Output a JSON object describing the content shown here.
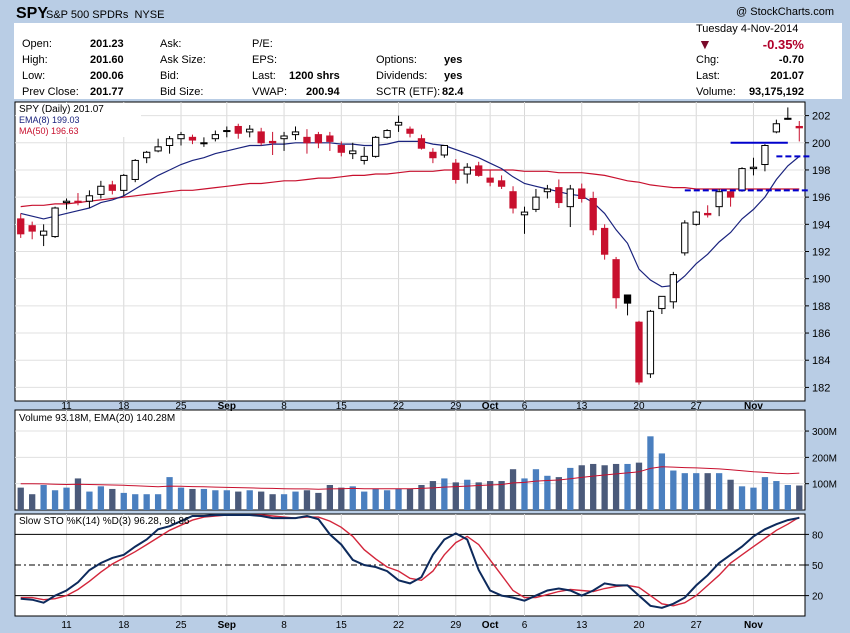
{
  "header": {
    "ticker": "SPY",
    "name": "S&P 500 SPDRs",
    "exchange": "NYSE",
    "copyright": "@ StockCharts.com",
    "date": "Tuesday  4-Nov-2014",
    "change_pct": "-0.35%",
    "fields": {
      "open_label": "Open:",
      "open": "201.23",
      "high_label": "High:",
      "high": "201.60",
      "low_label": "Low:",
      "low": "200.06",
      "prev_label": "Prev Close:",
      "prev": "201.77",
      "ask_label": "Ask:",
      "ask": "",
      "asksize_label": "Ask Size:",
      "asksize": "",
      "bid_label": "Bid:",
      "bid": "",
      "bidsize_label": "Bid Size:",
      "bidsize": "",
      "pe_label": "P/E:",
      "pe": "",
      "eps_label": "EPS:",
      "eps": "",
      "last_label": "Last:",
      "last": "1200 shrs",
      "vwap_label": "VWAP:",
      "vwap": "200.94",
      "options_label": "Options:",
      "options": "yes",
      "dividends_label": "Dividends:",
      "dividends": "yes",
      "sctr_label": "SCTR (ETF):",
      "sctr": "82.4",
      "chg_label": "Chg:",
      "chg": "-0.70",
      "last2_label": "Last:",
      "last2": "201.07",
      "volume_label": "Volume:",
      "volume": "93,175,192"
    }
  },
  "colors": {
    "up": "#ffffff",
    "down": "#c8102e",
    "ema": "#1a237e",
    "ma": "#c8102e",
    "vol_up": "#4a7fbf",
    "vol_down": "#4b5a7a",
    "stoK": "#0d2a5c",
    "stoD": "#d3263b",
    "bg": "#b9cde5"
  },
  "chart_data": [
    {
      "type": "candlestick",
      "legend": [
        "SPY (Daily) 201.07",
        "EMA(8) 199.03",
        "MA(50) 196.63"
      ],
      "x_labels": [
        "11",
        "18",
        "25",
        "Sep",
        "8",
        "15",
        "22",
        "29",
        "Oct",
        "6",
        "13",
        "20",
        "27",
        "Nov"
      ],
      "ylim": [
        181,
        203
      ],
      "y_ticks": [
        182,
        184,
        186,
        188,
        190,
        192,
        194,
        196,
        198,
        200,
        202
      ],
      "candles": [
        [
          194.4,
          194.8,
          193.0,
          193.3
        ],
        [
          193.9,
          194.2,
          192.9,
          193.5
        ],
        [
          193.2,
          194.0,
          192.4,
          193.5
        ],
        [
          193.1,
          195.3,
          193.0,
          195.2
        ],
        [
          195.6,
          195.9,
          195.1,
          195.7
        ],
        [
          195.7,
          196.3,
          195.4,
          195.6
        ],
        [
          195.7,
          196.5,
          195.2,
          196.1
        ],
        [
          196.2,
          197.2,
          195.9,
          196.8
        ],
        [
          196.9,
          197.2,
          196.2,
          196.5
        ],
        [
          196.5,
          197.7,
          196.1,
          197.6
        ],
        [
          197.3,
          198.8,
          197.1,
          198.7
        ],
        [
          198.9,
          199.4,
          198.5,
          199.3
        ],
        [
          199.4,
          200.3,
          199.3,
          199.7
        ],
        [
          199.8,
          200.5,
          199.2,
          200.3
        ],
        [
          200.3,
          200.8,
          199.8,
          200.6
        ],
        [
          200.4,
          200.6,
          199.9,
          200.2
        ],
        [
          200.0,
          200.4,
          199.7,
          200.0
        ],
        [
          200.3,
          200.9,
          200.1,
          200.6
        ],
        [
          200.9,
          201.2,
          200.4,
          200.9
        ],
        [
          201.2,
          201.4,
          200.3,
          200.7
        ],
        [
          200.8,
          201.3,
          200.4,
          201.0
        ],
        [
          200.8,
          201.1,
          199.8,
          200.0
        ],
        [
          200.1,
          200.8,
          199.1,
          200.0
        ],
        [
          200.3,
          200.8,
          199.4,
          200.5
        ],
        [
          200.6,
          201.2,
          200.2,
          200.8
        ],
        [
          200.4,
          201.0,
          199.2,
          200.0
        ],
        [
          200.6,
          200.8,
          199.6,
          200.0
        ],
        [
          200.5,
          200.8,
          199.4,
          200.1
        ],
        [
          199.8,
          200.1,
          199.0,
          199.3
        ],
        [
          199.2,
          200.0,
          198.8,
          199.4
        ],
        [
          198.7,
          199.7,
          198.4,
          199.0
        ],
        [
          199.0,
          200.5,
          198.9,
          200.4
        ],
        [
          200.4,
          201.0,
          200.3,
          200.9
        ],
        [
          201.3,
          202.0,
          200.8,
          201.5
        ],
        [
          201.0,
          201.2,
          200.4,
          200.7
        ],
        [
          200.3,
          200.6,
          199.5,
          199.6
        ],
        [
          199.3,
          199.6,
          198.5,
          198.9
        ],
        [
          199.1,
          199.8,
          198.9,
          199.8
        ],
        [
          198.5,
          198.8,
          197.0,
          197.3
        ],
        [
          197.7,
          198.5,
          197.0,
          198.2
        ],
        [
          198.3,
          198.6,
          197.5,
          197.6
        ],
        [
          197.4,
          198.0,
          196.8,
          197.1
        ],
        [
          197.2,
          197.6,
          196.6,
          196.8
        ],
        [
          196.4,
          196.8,
          194.8,
          195.2
        ],
        [
          194.7,
          195.3,
          193.3,
          194.9
        ],
        [
          195.1,
          196.6,
          194.9,
          196.0
        ],
        [
          196.4,
          196.9,
          195.9,
          196.6
        ],
        [
          196.7,
          197.3,
          195.2,
          195.6
        ],
        [
          195.3,
          196.9,
          193.8,
          196.6
        ],
        [
          196.6,
          197.0,
          195.6,
          195.9
        ],
        [
          195.9,
          196.4,
          193.2,
          193.6
        ],
        [
          193.7,
          194.0,
          191.4,
          191.8
        ],
        [
          191.4,
          191.6,
          187.8,
          188.6
        ],
        [
          188.2,
          188.7,
          187.3,
          188.8
        ],
        [
          186.8,
          186.9,
          182.2,
          182.4
        ],
        [
          183.0,
          187.7,
          182.7,
          187.6
        ],
        [
          187.8,
          188.7,
          187.4,
          188.7
        ],
        [
          188.3,
          190.5,
          187.8,
          190.3
        ],
        [
          191.9,
          194.3,
          191.7,
          194.1
        ],
        [
          194.0,
          195.0,
          193.9,
          194.9
        ],
        [
          194.8,
          195.4,
          194.5,
          194.7
        ],
        [
          195.3,
          196.6,
          194.6,
          196.4
        ],
        [
          196.4,
          196.5,
          195.3,
          196.0
        ],
        [
          196.5,
          198.2,
          196.4,
          198.1
        ],
        [
          198.1,
          198.9,
          197.6,
          198.2
        ],
        [
          198.4,
          199.9,
          197.9,
          199.8
        ],
        [
          200.8,
          201.7,
          200.7,
          201.4
        ],
        [
          201.8,
          202.6,
          201.7,
          201.8
        ],
        [
          201.2,
          201.6,
          200.1,
          201.1
        ]
      ],
      "ema8": [
        194.8,
        194.6,
        194.4,
        194.6,
        194.8,
        195.0,
        195.2,
        195.6,
        195.8,
        196.1,
        196.6,
        197.1,
        197.6,
        198.0,
        198.4,
        198.7,
        198.9,
        199.2,
        199.4,
        199.6,
        199.8,
        199.8,
        199.9,
        199.9,
        200.0,
        200.0,
        200.0,
        200.0,
        199.9,
        199.9,
        199.8,
        199.8,
        199.9,
        200.1,
        200.1,
        200.1,
        199.9,
        199.8,
        199.5,
        199.2,
        198.9,
        198.5,
        198.1,
        197.5,
        197.0,
        196.8,
        196.6,
        196.4,
        196.2,
        196.1,
        195.6,
        194.8,
        193.6,
        192.6,
        190.7,
        189.9,
        189.4,
        189.5,
        190.2,
        191.1,
        191.8,
        192.7,
        193.4,
        194.4,
        195.1,
        196.0,
        197.3,
        198.3,
        199.0
      ],
      "ma50": [
        195.3,
        195.4,
        195.4,
        195.5,
        195.5,
        195.6,
        195.7,
        195.8,
        195.9,
        196.0,
        196.1,
        196.2,
        196.3,
        196.4,
        196.5,
        196.5,
        196.6,
        196.7,
        196.8,
        196.9,
        197.0,
        197.0,
        197.1,
        197.2,
        197.2,
        197.3,
        197.4,
        197.4,
        197.5,
        197.6,
        197.6,
        197.7,
        197.7,
        197.8,
        197.9,
        197.9,
        197.9,
        198.0,
        198.0,
        198.0,
        198.0,
        198.0,
        198.0,
        198.0,
        197.9,
        197.9,
        197.9,
        197.8,
        197.8,
        197.8,
        197.7,
        197.6,
        197.4,
        197.2,
        197.1,
        196.9,
        196.8,
        196.7,
        196.7,
        196.6,
        196.6,
        196.6,
        196.6,
        196.6,
        196.6,
        196.6,
        196.6,
        196.6,
        196.6
      ],
      "annotations": [
        {
          "type": "hline",
          "y": 200.0,
          "from_index": 62,
          "to_index": 66,
          "style": "solid"
        },
        {
          "type": "hline",
          "y": 199.0,
          "from_index": 66,
          "to_index": 68,
          "style": "dashed"
        },
        {
          "type": "hline",
          "y": 196.5,
          "from_index": 58,
          "to_index": 68,
          "style": "dashed"
        }
      ]
    },
    {
      "type": "bar",
      "legend": "Volume 93.18M, EMA(20) 140.28M",
      "ylim": [
        0,
        380
      ],
      "y_ticks": [
        {
          "v": 100,
          "label": "100M"
        },
        {
          "v": 200,
          "label": "200M"
        },
        {
          "v": 300,
          "label": "300M"
        }
      ],
      "values": [
        85,
        60,
        95,
        75,
        85,
        120,
        70,
        90,
        80,
        65,
        60,
        60,
        60,
        125,
        85,
        80,
        80,
        75,
        75,
        70,
        75,
        70,
        60,
        60,
        70,
        75,
        65,
        95,
        85,
        90,
        70,
        80,
        75,
        80,
        80,
        95,
        110,
        120,
        105,
        115,
        105,
        110,
        110,
        155,
        120,
        155,
        130,
        125,
        160,
        170,
        175,
        170,
        175,
        175,
        180,
        280,
        215,
        150,
        140,
        140,
        140,
        140,
        115,
        90,
        85,
        125,
        110,
        95,
        93
      ],
      "ema20": [
        100,
        100,
        99,
        98,
        97,
        98,
        97,
        96,
        95,
        94,
        92,
        90,
        88,
        91,
        90,
        89,
        88,
        87,
        86,
        85,
        84,
        83,
        82,
        81,
        80,
        80,
        79,
        80,
        81,
        82,
        81,
        81,
        81,
        81,
        81,
        82,
        84,
        87,
        89,
        91,
        93,
        95,
        97,
        103,
        105,
        110,
        112,
        114,
        119,
        124,
        129,
        133,
        137,
        141,
        145,
        158,
        164,
        163,
        161,
        160,
        158,
        156,
        153,
        149,
        145,
        143,
        140,
        138,
        140.28
      ]
    },
    {
      "type": "line",
      "legend": "Slow STO %K(14) %D(3) 96.28, 96.86",
      "ylim": [
        0,
        100
      ],
      "y_ticks": [
        20,
        50,
        80
      ],
      "series": [
        {
          "name": "%K",
          "values": [
            17,
            16,
            13,
            20,
            25,
            33,
            45,
            52,
            57,
            60,
            68,
            75,
            85,
            88,
            93,
            98,
            98,
            99,
            99,
            99,
            99,
            98,
            96,
            96,
            96,
            98,
            95,
            80,
            70,
            55,
            50,
            48,
            44,
            35,
            32,
            38,
            60,
            75,
            81,
            75,
            45,
            25,
            20,
            18,
            15,
            20,
            25,
            27,
            25,
            20,
            25,
            32,
            30,
            30,
            20,
            10,
            8,
            12,
            18,
            30,
            40,
            52,
            60,
            68,
            78,
            85,
            90,
            94,
            96.28
          ]
        },
        {
          "name": "%D",
          "values": [
            18,
            18,
            16,
            17,
            20,
            26,
            34,
            43,
            51,
            57,
            63,
            70,
            77,
            84,
            89,
            94,
            97,
            98,
            99,
            99,
            99,
            99,
            98,
            97,
            96,
            97,
            97,
            93,
            87,
            78,
            65,
            56,
            48,
            44,
            37,
            35,
            44,
            60,
            72,
            78,
            70,
            55,
            40,
            25,
            18,
            18,
            21,
            24,
            26,
            25,
            24,
            27,
            29,
            30,
            28,
            20,
            12,
            10,
            13,
            20,
            30,
            40,
            52,
            60,
            68,
            76,
            84,
            90,
            96.86
          ]
        }
      ]
    }
  ]
}
